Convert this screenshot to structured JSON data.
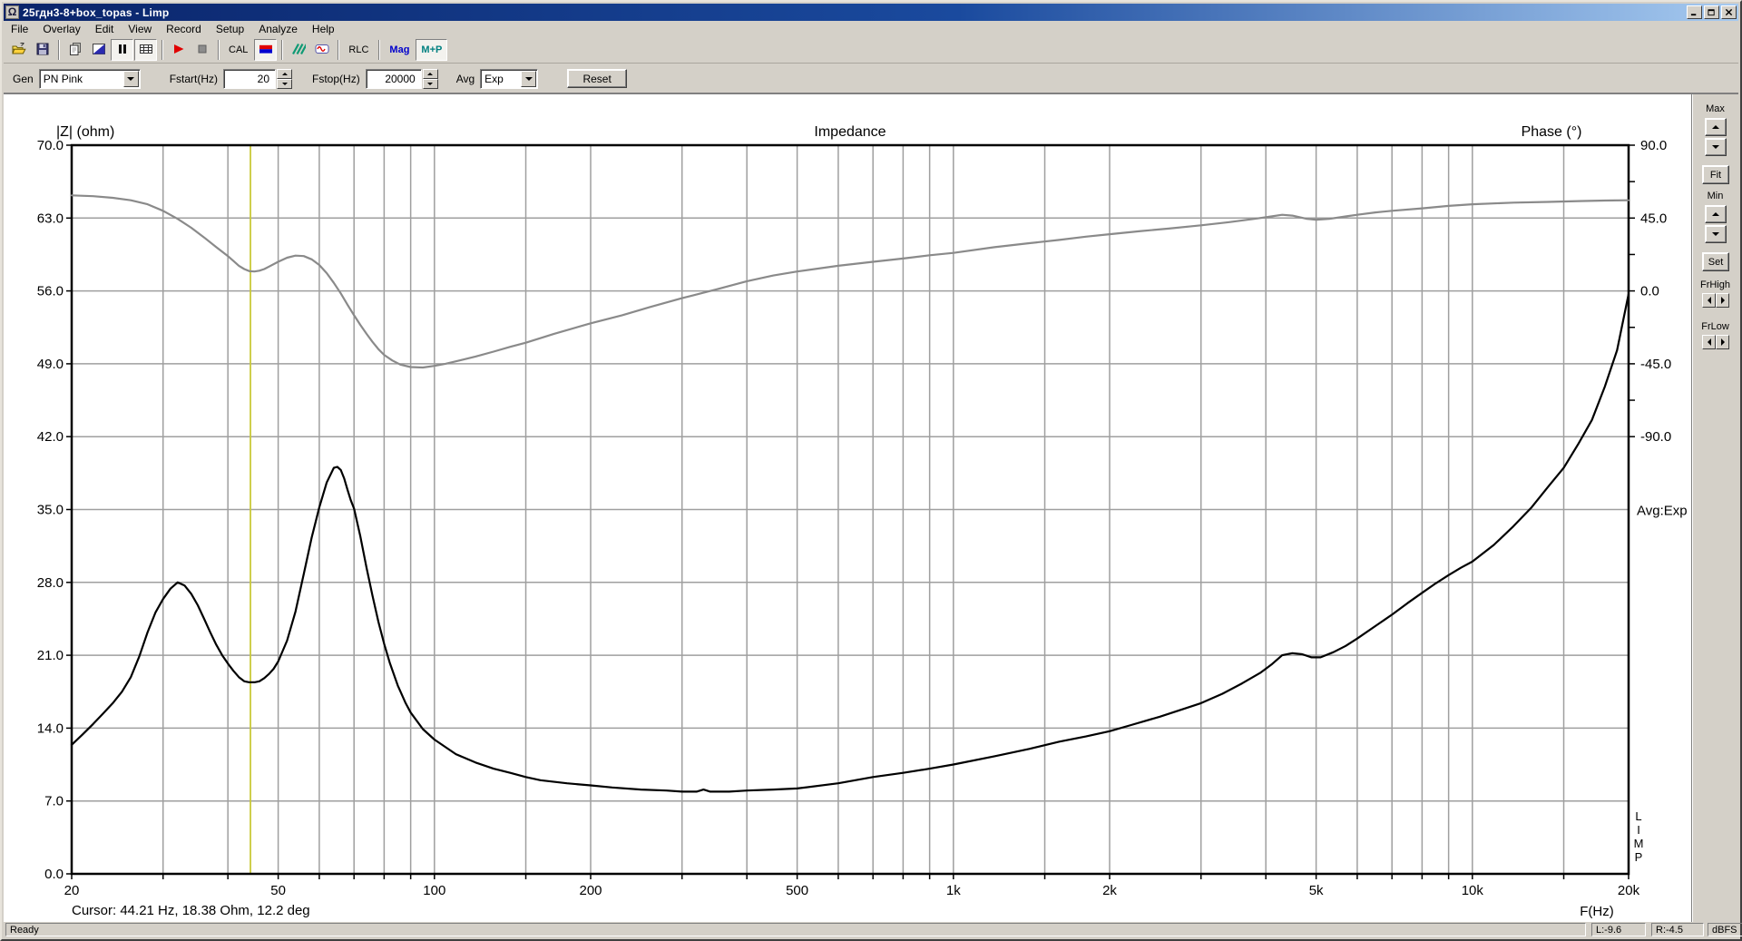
{
  "window": {
    "title": "25гдн3-8+box_topas - Limp",
    "icon": "Ω"
  },
  "menu": {
    "items": [
      "File",
      "Overlay",
      "Edit",
      "View",
      "Record",
      "Setup",
      "Analyze",
      "Help"
    ]
  },
  "toolbar": {
    "buttons": [
      {
        "name": "open-button",
        "icon": "open-folder-icon"
      },
      {
        "name": "save-button",
        "icon": "save-icon"
      },
      {
        "sep": true
      },
      {
        "name": "overlay-copy-button",
        "icon": "copy-document-icon"
      },
      {
        "name": "background-color-button",
        "icon": "diagonal-split-icon"
      },
      {
        "name": "pause-button",
        "icon": "pause-icon",
        "pressed": true
      },
      {
        "name": "table-view-button",
        "icon": "grid-icon",
        "pressed": true
      },
      {
        "sep": true
      },
      {
        "name": "start-recording-button",
        "icon": "play-icon"
      },
      {
        "name": "stop-recording-button",
        "icon": "stop-icon"
      },
      {
        "sep": true
      },
      {
        "name": "calibrate-button",
        "label": "CAL",
        "label_color": "#000000"
      },
      {
        "name": "graph-colors-button",
        "icon": "red-blue-icon",
        "pressed": true
      },
      {
        "sep": true
      },
      {
        "name": "spectrum-button",
        "icon": "green-stripes-icon"
      },
      {
        "name": "generator-button",
        "icon": "sine-wave-icon"
      },
      {
        "sep": true
      },
      {
        "name": "rlc-button",
        "label": "RLC",
        "label_color": "#000000"
      },
      {
        "sep": true
      },
      {
        "name": "magnitude-button",
        "label": "Mag",
        "label_color": "#0000cc",
        "bold": true
      },
      {
        "name": "mag-phase-button",
        "label": "M+P",
        "label_color": "#008080",
        "bold": true,
        "pressed": true
      }
    ]
  },
  "settings": {
    "gen_label": "Gen",
    "gen_value": "PN Pink",
    "fstart_label": "Fstart(Hz)",
    "fstart_value": "20",
    "fstop_label": "Fstop(Hz)",
    "fstop_value": "20000",
    "avg_label": "Avg",
    "avg_value": "Exp",
    "reset_label": "Reset"
  },
  "side_panel": {
    "max_label": "Max",
    "fit_label": "Fit",
    "min_label": "Min",
    "set_label": "Set",
    "frhigh_label": "FrHigh",
    "frlow_label": "FrLow"
  },
  "status_bar": {
    "ready": "Ready",
    "left_level": "L:-9.6",
    "right_level": "R:-4.5",
    "units": "dBFS"
  },
  "chart_data": {
    "type": "line",
    "title": "Impedance",
    "x": {
      "label": "F(Hz)",
      "scale": "log",
      "min": 20,
      "max": 20000,
      "major_ticks": [
        {
          "label": "20",
          "f": 20
        },
        {
          "label": "50",
          "f": 50
        },
        {
          "label": "100",
          "f": 100
        },
        {
          "label": "200",
          "f": 200
        },
        {
          "label": "500",
          "f": 500
        },
        {
          "label": "1k",
          "f": 1000
        },
        {
          "label": "2k",
          "f": 2000
        },
        {
          "label": "5k",
          "f": 5000
        },
        {
          "label": "10k",
          "f": 10000
        },
        {
          "label": "20k",
          "f": 20000
        }
      ],
      "gridlines": [
        30,
        40,
        50,
        60,
        70,
        80,
        90,
        100,
        150,
        200,
        300,
        400,
        500,
        600,
        700,
        800,
        900,
        1000,
        1500,
        2000,
        3000,
        4000,
        5000,
        6000,
        7000,
        8000,
        9000,
        10000,
        15000
      ]
    },
    "y_left": {
      "label": "|Z| (ohm)",
      "min": 0,
      "max": 70,
      "ticks": [
        "70.0",
        "63.0",
        "56.0",
        "49.0",
        "42.0",
        "35.0",
        "28.0",
        "21.0",
        "14.0",
        "7.0",
        "0.0"
      ]
    },
    "y_right": {
      "label": "Phase (°)",
      "ticks": [
        "90.0",
        "45.0",
        "0.0",
        "-45.0",
        "-90.0"
      ],
      "top_value": 90,
      "degrees_per_division": 45
    },
    "grid_color": "#9f9f9f",
    "cursor": {
      "freq": 44.21,
      "line_color": "#c9c93a",
      "text": "Cursor: 44.21 Hz, 18.38 Ohm, 12.2 deg"
    },
    "annotations": {
      "avg_mode": "Avg:Exp",
      "watermark": "LIMP"
    },
    "series": [
      {
        "name": "impedance-magnitude",
        "axis": "left",
        "color": "#000000",
        "points": [
          [
            20,
            12.4
          ],
          [
            21,
            13.4
          ],
          [
            22,
            14.4
          ],
          [
            23,
            15.4
          ],
          [
            24,
            16.4
          ],
          [
            25,
            17.5
          ],
          [
            26,
            18.9
          ],
          [
            27,
            20.9
          ],
          [
            28,
            23.2
          ],
          [
            29,
            25.1
          ],
          [
            30,
            26.4
          ],
          [
            31,
            27.4
          ],
          [
            32,
            28.0
          ],
          [
            33,
            27.7
          ],
          [
            34,
            26.9
          ],
          [
            35,
            25.8
          ],
          [
            36,
            24.5
          ],
          [
            37,
            23.2
          ],
          [
            38,
            22.0
          ],
          [
            39,
            21.0
          ],
          [
            40,
            20.2
          ],
          [
            41,
            19.5
          ],
          [
            42,
            18.9
          ],
          [
            43,
            18.5
          ],
          [
            44,
            18.4
          ],
          [
            45,
            18.4
          ],
          [
            46,
            18.5
          ],
          [
            47,
            18.8
          ],
          [
            48,
            19.2
          ],
          [
            49,
            19.7
          ],
          [
            50,
            20.4
          ],
          [
            52,
            22.4
          ],
          [
            54,
            25.2
          ],
          [
            56,
            28.8
          ],
          [
            58,
            32.3
          ],
          [
            60,
            35.2
          ],
          [
            62,
            37.6
          ],
          [
            64,
            39.0
          ],
          [
            65,
            39.1
          ],
          [
            66,
            38.8
          ],
          [
            67,
            38.0
          ],
          [
            68,
            36.9
          ],
          [
            69,
            35.9
          ],
          [
            70,
            35.1
          ],
          [
            72,
            32.4
          ],
          [
            74,
            29.4
          ],
          [
            76,
            26.7
          ],
          [
            78,
            24.2
          ],
          [
            80,
            22.1
          ],
          [
            82,
            20.3
          ],
          [
            85,
            18.1
          ],
          [
            88,
            16.4
          ],
          [
            90,
            15.5
          ],
          [
            95,
            13.9
          ],
          [
            100,
            12.9
          ],
          [
            110,
            11.5
          ],
          [
            120,
            10.7
          ],
          [
            130,
            10.1
          ],
          [
            140,
            9.7
          ],
          [
            150,
            9.3
          ],
          [
            160,
            9.0
          ],
          [
            180,
            8.7
          ],
          [
            200,
            8.5
          ],
          [
            220,
            8.3
          ],
          [
            250,
            8.1
          ],
          [
            280,
            8.0
          ],
          [
            300,
            7.9
          ],
          [
            320,
            7.9
          ],
          [
            330,
            8.1
          ],
          [
            340,
            7.9
          ],
          [
            370,
            7.9
          ],
          [
            400,
            8.0
          ],
          [
            450,
            8.1
          ],
          [
            500,
            8.2
          ],
          [
            600,
            8.7
          ],
          [
            700,
            9.3
          ],
          [
            800,
            9.7
          ],
          [
            900,
            10.1
          ],
          [
            1000,
            10.5
          ],
          [
            1200,
            11.3
          ],
          [
            1400,
            12.0
          ],
          [
            1600,
            12.7
          ],
          [
            1800,
            13.2
          ],
          [
            2000,
            13.7
          ],
          [
            2200,
            14.3
          ],
          [
            2500,
            15.1
          ],
          [
            2800,
            15.9
          ],
          [
            3000,
            16.4
          ],
          [
            3300,
            17.3
          ],
          [
            3600,
            18.3
          ],
          [
            3900,
            19.3
          ],
          [
            4100,
            20.1
          ],
          [
            4300,
            21.0
          ],
          [
            4500,
            21.2
          ],
          [
            4700,
            21.1
          ],
          [
            4900,
            20.8
          ],
          [
            5100,
            20.8
          ],
          [
            5400,
            21.3
          ],
          [
            5700,
            21.9
          ],
          [
            6000,
            22.6
          ],
          [
            6500,
            23.8
          ],
          [
            7000,
            24.9
          ],
          [
            7500,
            26.0
          ],
          [
            8000,
            27.0
          ],
          [
            8500,
            27.9
          ],
          [
            9000,
            28.7
          ],
          [
            9500,
            29.4
          ],
          [
            10000,
            30.0
          ],
          [
            11000,
            31.6
          ],
          [
            12000,
            33.4
          ],
          [
            13000,
            35.2
          ],
          [
            14000,
            37.2
          ],
          [
            15000,
            39.0
          ],
          [
            16000,
            41.3
          ],
          [
            17000,
            43.6
          ],
          [
            18000,
            46.8
          ],
          [
            19000,
            50.3
          ],
          [
            20000,
            55.7
          ]
        ]
      },
      {
        "name": "impedance-phase",
        "axis": "right",
        "color": "#8a8a8a",
        "points": [
          [
            20,
            59
          ],
          [
            22,
            58.5
          ],
          [
            24,
            57.5
          ],
          [
            26,
            56
          ],
          [
            28,
            53.5
          ],
          [
            30,
            49.5
          ],
          [
            32,
            44.5
          ],
          [
            34,
            39
          ],
          [
            36,
            33
          ],
          [
            38,
            27
          ],
          [
            40,
            21.5
          ],
          [
            41,
            18.5
          ],
          [
            42,
            15.5
          ],
          [
            43,
            13.5
          ],
          [
            44,
            12.2
          ],
          [
            45,
            12
          ],
          [
            46,
            12.5
          ],
          [
            47,
            13.5
          ],
          [
            48,
            15
          ],
          [
            50,
            18
          ],
          [
            52,
            20.5
          ],
          [
            54,
            21.8
          ],
          [
            56,
            21.5
          ],
          [
            58,
            19.5
          ],
          [
            60,
            16
          ],
          [
            62,
            11
          ],
          [
            64,
            5
          ],
          [
            66,
            -1.5
          ],
          [
            68,
            -8.5
          ],
          [
            70,
            -15
          ],
          [
            72,
            -21
          ],
          [
            74,
            -26.5
          ],
          [
            76,
            -31.5
          ],
          [
            78,
            -36
          ],
          [
            80,
            -39.5
          ],
          [
            83,
            -43
          ],
          [
            86,
            -45.5
          ],
          [
            90,
            -47
          ],
          [
            95,
            -47.3
          ],
          [
            100,
            -46.3
          ],
          [
            105,
            -45
          ],
          [
            110,
            -43.5
          ],
          [
            120,
            -40.5
          ],
          [
            130,
            -37.5
          ],
          [
            140,
            -34.5
          ],
          [
            150,
            -32
          ],
          [
            170,
            -26.5
          ],
          [
            200,
            -20
          ],
          [
            230,
            -15
          ],
          [
            260,
            -10
          ],
          [
            300,
            -4.5
          ],
          [
            350,
            1
          ],
          [
            400,
            6
          ],
          [
            450,
            9.5
          ],
          [
            500,
            12
          ],
          [
            600,
            15.5
          ],
          [
            700,
            18
          ],
          [
            800,
            20
          ],
          [
            900,
            22
          ],
          [
            1000,
            23.5
          ],
          [
            1200,
            27
          ],
          [
            1400,
            29.5
          ],
          [
            1600,
            31.5
          ],
          [
            1800,
            33.5
          ],
          [
            2000,
            35
          ],
          [
            2300,
            37
          ],
          [
            2600,
            38.5
          ],
          [
            3000,
            40.5
          ],
          [
            3400,
            42.5
          ],
          [
            3800,
            44.5
          ],
          [
            4100,
            46
          ],
          [
            4300,
            47
          ],
          [
            4500,
            46.5
          ],
          [
            4800,
            44.5
          ],
          [
            5000,
            44
          ],
          [
            5300,
            44.5
          ],
          [
            5700,
            46
          ],
          [
            6000,
            47
          ],
          [
            6500,
            48.5
          ],
          [
            7000,
            49.5
          ],
          [
            8000,
            51
          ],
          [
            9000,
            52.5
          ],
          [
            10000,
            53.5
          ],
          [
            12000,
            54.5
          ],
          [
            14000,
            55
          ],
          [
            16000,
            55.5
          ],
          [
            18000,
            55.8
          ],
          [
            20000,
            56
          ]
        ]
      }
    ]
  }
}
